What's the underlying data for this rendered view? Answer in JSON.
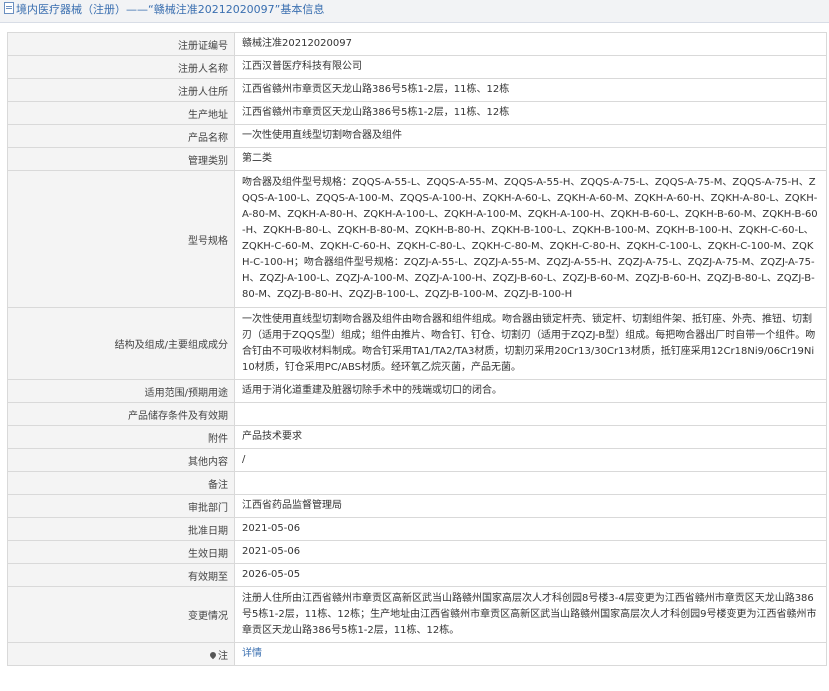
{
  "header": {
    "text": "境内医疗器械（注册）——“赣械注准20212020097”基本信息",
    "icon": "document-icon"
  },
  "rows": {
    "reg_no": {
      "label": "注册证编号",
      "value": "赣械注准20212020097"
    },
    "registrant": {
      "label": "注册人名称",
      "value": "江西汉普医疗科技有限公司"
    },
    "registrant_address": {
      "label": "注册人住所",
      "value": "江西省赣州市章贡区天龙山路386号5栋1-2层，11栋、12栋"
    },
    "production_address": {
      "label": "生产地址",
      "value": "江西省赣州市章贡区天龙山路386号5栋1-2层，11栋、12栋"
    },
    "product_name": {
      "label": "产品名称",
      "value": "一次性使用直线型切割吻合器及组件"
    },
    "category": {
      "label": "管理类别",
      "value": "第二类"
    },
    "models": {
      "label": "型号规格",
      "value": "吻合器及组件型号规格：ZQQS-A-55-L、ZQQS-A-55-M、ZQQS-A-55-H、ZQQS-A-75-L、ZQQS-A-75-M、ZQQS-A-75-H、ZQQS-A-100-L、ZQQS-A-100-M、ZQQS-A-100-H、ZQKH-A-60-L、ZQKH-A-60-M、ZQKH-A-60-H、ZQKH-A-80-L、ZQKH-A-80-M、ZQKH-A-80-H、ZQKH-A-100-L、ZQKH-A-100-M、ZQKH-A-100-H、ZQKH-B-60-L、ZQKH-B-60-M、ZQKH-B-60-H、ZQKH-B-80-L、ZQKH-B-80-M、ZQKH-B-80-H、ZQKH-B-100-L、ZQKH-B-100-M、ZQKH-B-100-H、ZQKH-C-60-L、ZQKH-C-60-M、ZQKH-C-60-H、ZQKH-C-80-L、ZQKH-C-80-M、ZQKH-C-80-H、ZQKH-C-100-L、ZQKH-C-100-M、ZQKH-C-100-H；吻合器组件型号规格：ZQZJ-A-55-L、ZQZJ-A-55-M、ZQZJ-A-55-H、ZQZJ-A-75-L、ZQZJ-A-75-M、ZQZJ-A-75-H、ZQZJ-A-100-L、ZQZJ-A-100-M、ZQZJ-A-100-H、ZQZJ-B-60-L、ZQZJ-B-60-M、ZQZJ-B-60-H、ZQZJ-B-80-L、ZQZJ-B-80-M、ZQZJ-B-80-H、ZQZJ-B-100-L、ZQZJ-B-100-M、ZQZJ-B-100-H"
    },
    "structure": {
      "label": "结构及组成/主要组成成分",
      "value": "一次性使用直线型切割吻合器及组件由吻合器和组件组成。吻合器由锁定杆壳、锁定杆、切割组件架、抵钉座、外壳、推钮、切割刃（适用于ZQQS型）组成；组件由推片、吻合钉、钉仓、切割刃（适用于ZQZJ-B型）组成。每把吻合器出厂时自带一个组件。吻合钉由不可吸收材料制成。吻合钉采用TA1/TA2/TA3材质，切割刃采用20Cr13/30Cr13材质，抵钉座采用12Cr18Ni9/06Cr19Ni10材质，钉仓采用PC/ABS材质。经环氧乙烷灭菌，产品无菌。"
    },
    "scope": {
      "label": "适用范围/预期用途",
      "value": "适用于消化道重建及脏器切除手术中的残端或切口的闭合。"
    },
    "storage": {
      "label": "产品储存条件及有效期",
      "value": ""
    },
    "attachment": {
      "label": "附件",
      "value": "产品技术要求"
    },
    "other": {
      "label": "其他内容",
      "value": "/"
    },
    "remark": {
      "label": "备注",
      "value": ""
    },
    "approver": {
      "label": "审批部门",
      "value": "江西省药品监督管理局"
    },
    "approval_date": {
      "label": "批准日期",
      "value": "2021-05-06"
    },
    "effective_date": {
      "label": "生效日期",
      "value": "2021-05-06"
    },
    "expiry": {
      "label": "有效期至",
      "value": "2026-05-05"
    },
    "changes": {
      "label": "变更情况",
      "value": "注册人住所由江西省赣州市章贡区高新区武当山路赣州国家高层次人才科创园8号楼3-4层变更为江西省赣州市章贡区天龙山路386号5栋1-2层，11栋、12栋；生产地址由江西省赣州市章贡区高新区武当山路赣州国家高层次人才科创园9号楼变更为江西省赣州市章贡区天龙山路386号5栋1-2层，11栋、12栋。"
    },
    "note": {
      "label": "注",
      "value": "详情",
      "icon": "pin-icon"
    }
  }
}
